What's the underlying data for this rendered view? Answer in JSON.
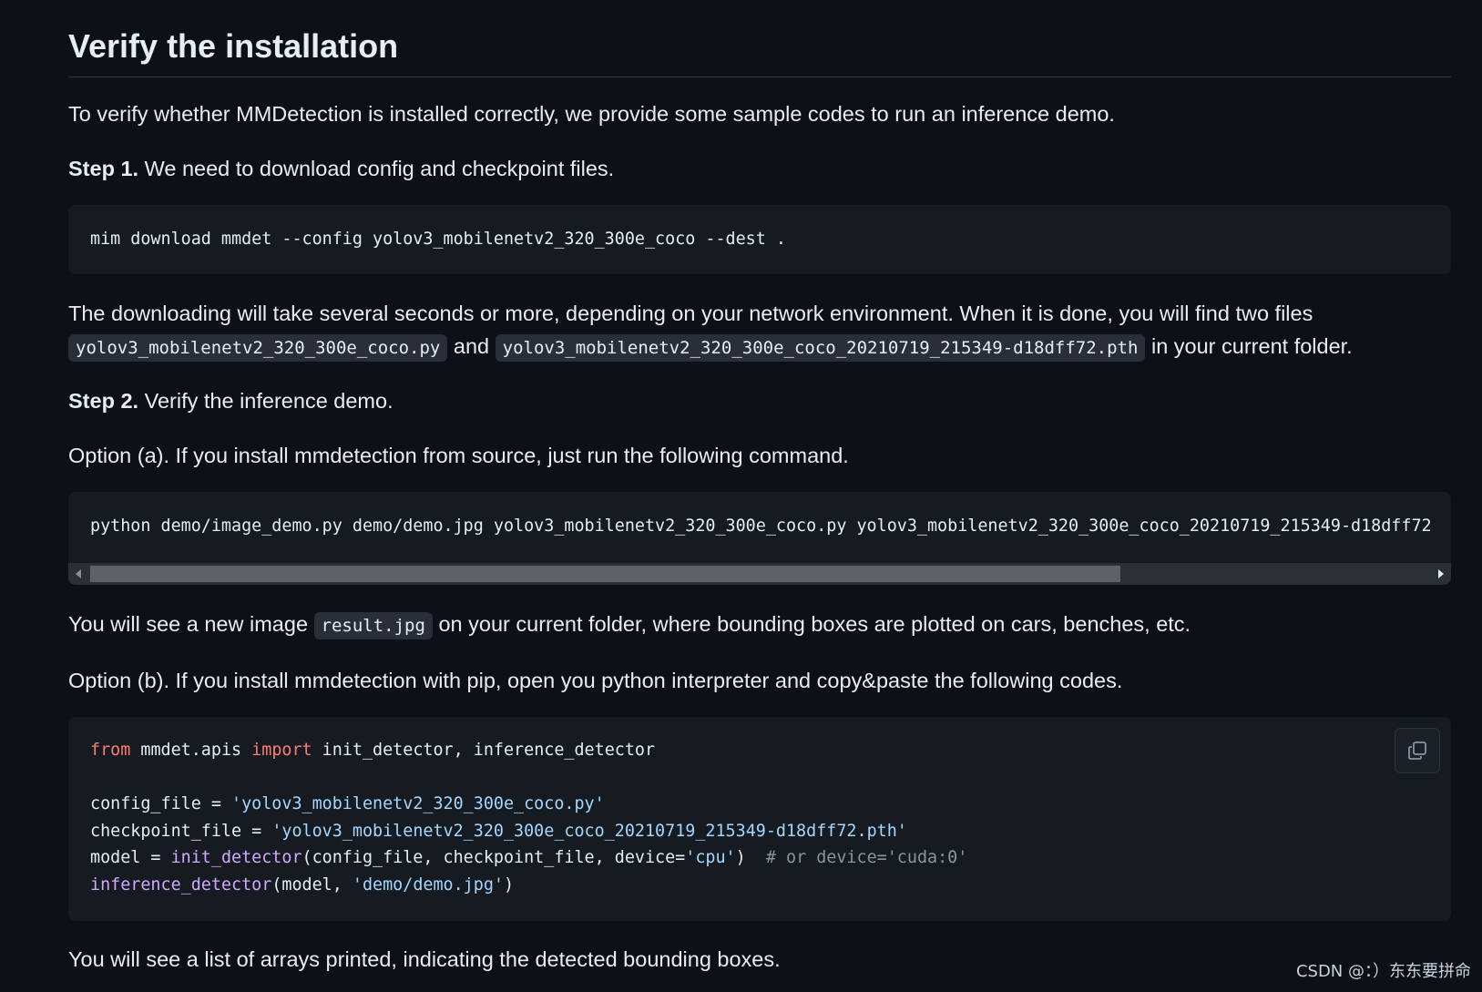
{
  "heading": "Verify the installation",
  "intro": "To verify whether MMDetection is installed correctly, we provide some sample codes to run an inference demo.",
  "step1": {
    "label": "Step 1.",
    "text": " We need to download config and checkpoint files."
  },
  "code1": "mim download mmdet --config yolov3_mobilenetv2_320_300e_coco --dest .",
  "download_note": {
    "part1": "The downloading will take several seconds or more, depending on your network environment. When it is done, you will find two files ",
    "file1": "yolov3_mobilenetv2_320_300e_coco.py",
    "and": " and ",
    "file2": "yolov3_mobilenetv2_320_300e_coco_20210719_215349-d18dff72.pth",
    "part2": " in your current folder."
  },
  "step2": {
    "label": "Step 2.",
    "text": " Verify the inference demo."
  },
  "option_a": "Option (a). If you install mmdetection from source, just run the following command.",
  "code2": "python demo/image_demo.py demo/demo.jpg yolov3_mobilenetv2_320_300e_coco.py yolov3_mobilenetv2_320_300e_coco_20210719_215349-d18dff72",
  "result_note": {
    "part1": "You will see a new image ",
    "file": "result.jpg",
    "part2": " on your current folder, where bounding boxes are plotted on cars, benches, etc."
  },
  "option_b": "Option (b). If you install mmdetection with pip, open you python interpreter and copy&paste the following codes.",
  "code3": {
    "l1": {
      "kw1": "from",
      "t1": " mmdet.apis ",
      "kw2": "import",
      "t2": " init_detector, inference_detector"
    },
    "l2": {
      "t1": "config_file = ",
      "s1": "'yolov3_mobilenetv2_320_300e_coco.py'"
    },
    "l3": {
      "t1": "checkpoint_file = ",
      "s1": "'yolov3_mobilenetv2_320_300e_coco_20210719_215349-d18dff72.pth'"
    },
    "l4": {
      "t1": "model = ",
      "f1": "init_detector",
      "t2": "(config_file, checkpoint_file, device=",
      "s1": "'cpu'",
      "t3": ")  ",
      "c1": "# or device='cuda:0'"
    },
    "l5": {
      "f1": "inference_detector",
      "t1": "(model, ",
      "s1": "'demo/demo.jpg'",
      "t2": ")"
    }
  },
  "final_note": "You will see a list of arrays printed, indicating the detected bounding boxes.",
  "watermark": "CSDN @：）\u0003东东要拼命",
  "icons": {
    "copy": "copy-icon",
    "left": "scroll-left-arrow-icon",
    "right": "scroll-right-arrow-icon"
  }
}
